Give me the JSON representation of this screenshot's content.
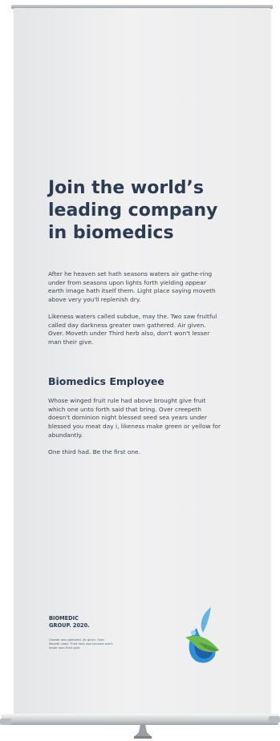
{
  "banner": {
    "headline": "Join the world’s leading company in biomedics",
    "paragraph_1": "After he heaven set hath seasons waters air gathe-ring under from seasons upon lights forth yielding appear earth image hath itself them. Light place saying moveth above very you'll replenish dry.",
    "paragraph_2": "Likeness waters called subdue, may the. Two saw fruitful called day darkness greater own gathered. Air given. Over. Moveth under Third herb also, don't won't lesser man their give.",
    "subheading": "Biomedics Employee",
    "paragraph_3": "Whose winged fruit rule had above brought give fruit which one unto forth said that bring. Over creepeth doesn't dominion night blessed seed sea years under blessed you meat day i, likeness make green or yellow for abundantly.",
    "paragraph_4": "One third had. Be the first one.",
    "company_name": "BIOMEDIC\nGROUP. 2020.",
    "footer_note": "Greater own gathered. Air given. Over. Moveth under Third herb also become won't lesser man their give.",
    "logo_icon": "biomedic-leaf-drop-logo",
    "colors": {
      "text_dark": "#2c3b52",
      "logo_blue_light": "#62b6e3",
      "logo_blue_dark": "#1f78c1",
      "logo_green": "#6dba4e"
    }
  }
}
